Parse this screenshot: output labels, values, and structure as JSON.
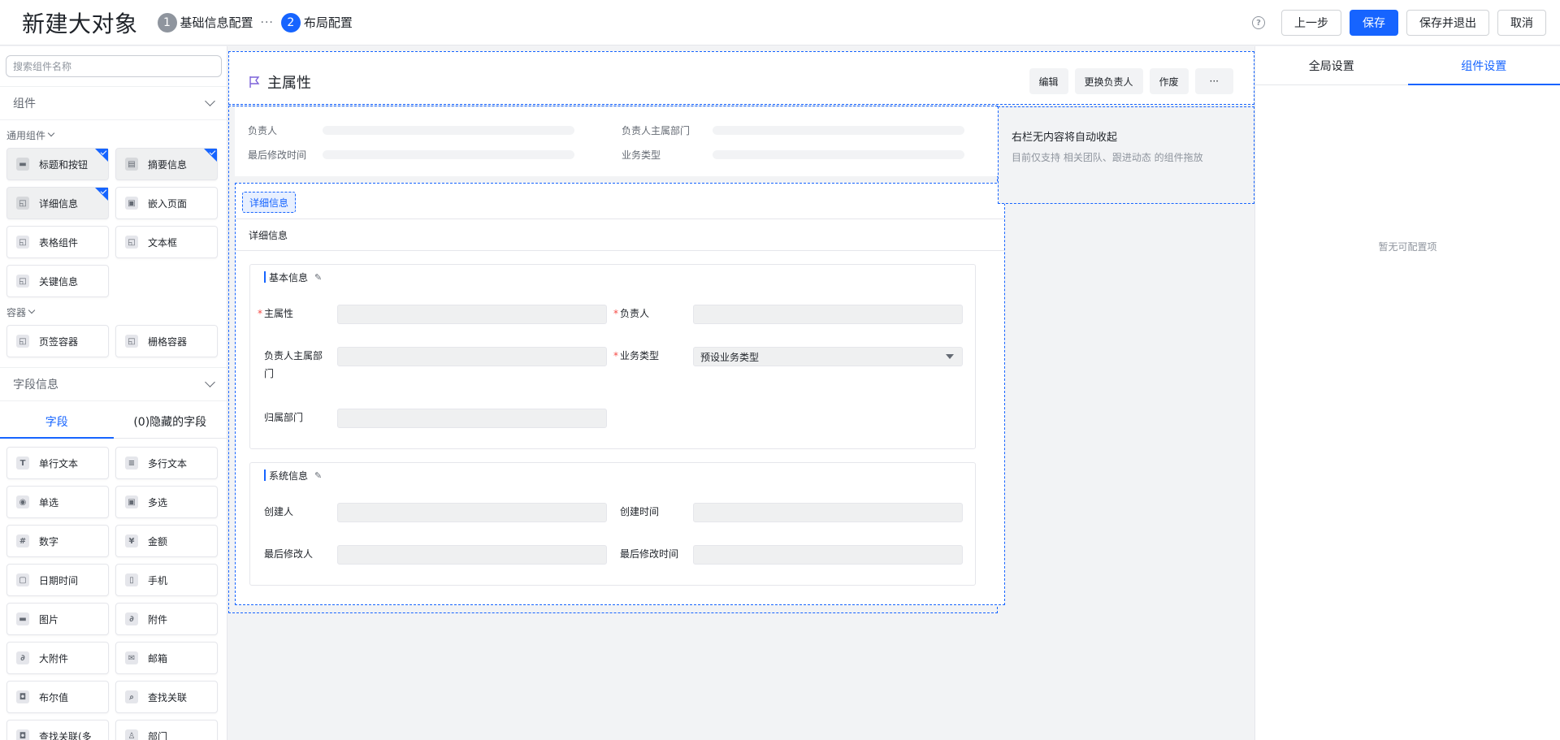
{
  "header": {
    "title": "新建大对象",
    "steps": [
      {
        "num": "1",
        "label": "基础信息配置"
      },
      {
        "num": "2",
        "label": "布局配置"
      }
    ],
    "dots": "···",
    "help_glyph": "?",
    "buttons": {
      "prev": "上一步",
      "save": "保存",
      "save_exit": "保存并退出",
      "cancel": "取消"
    }
  },
  "sidebar": {
    "search_placeholder": "搜索组件名称",
    "components_title": "组件",
    "common_label": "通用组件",
    "common_items": [
      "标题和按钮",
      "摘要信息",
      "详细信息",
      "嵌入页面",
      "表格组件",
      "文本框",
      "关键信息"
    ],
    "container_label": "容器",
    "container_items": [
      "页签容器",
      "栅格容器"
    ],
    "fields_title": "字段信息",
    "tabs": {
      "fields": "字段",
      "hidden": "(0)隐藏的字段"
    },
    "field_items": [
      {
        "label": "单行文本",
        "icon": "T"
      },
      {
        "label": "多行文本",
        "icon": "≡"
      },
      {
        "label": "单选",
        "icon": "◉"
      },
      {
        "label": "多选",
        "icon": "▣"
      },
      {
        "label": "数字",
        "icon": "#"
      },
      {
        "label": "金额",
        "icon": "¥"
      },
      {
        "label": "日期时间",
        "icon": "▢"
      },
      {
        "label": "手机",
        "icon": "▯"
      },
      {
        "label": "图片",
        "icon": "▬"
      },
      {
        "label": "附件",
        "icon": "∂"
      },
      {
        "label": "大附件",
        "icon": "∂"
      },
      {
        "label": "邮箱",
        "icon": "✉"
      },
      {
        "label": "布尔值",
        "icon": "◘"
      },
      {
        "label": "查找关联",
        "icon": "⌕"
      },
      {
        "label": "查找关联(多",
        "icon": "◘"
      },
      {
        "label": "部门",
        "icon": "♙"
      }
    ]
  },
  "canvas": {
    "header_title": "主属性",
    "header_buttons": [
      "编辑",
      "更换负责人",
      "作废",
      "···"
    ],
    "summary_labels": [
      "负责人",
      "负责人主属部门",
      "最后修改时间",
      "业务类型"
    ],
    "detail_tag": "详细信息",
    "detail_subtitle": "详细信息",
    "basic_title": "基本信息",
    "basic_fields": {
      "main_attr": "主属性",
      "owner": "负责人",
      "owner_dept": "负责人主属部",
      "owner_dept_wrap": "门",
      "biz_type": "业务类型",
      "biz_type_value": "预设业务类型",
      "belong_dept": "归属部门"
    },
    "system_title": "系统信息",
    "system_fields": {
      "creator": "创建人",
      "created_time": "创建时间",
      "last_modifier": "最后修改人",
      "last_modified_time": "最后修改时间"
    },
    "right_col": {
      "title": "右栏无内容将自动收起",
      "subtitle": "目前仅支持 相关团队、跟进动态 的组件拖放"
    }
  },
  "panel": {
    "tabs": [
      "全局设置",
      "组件设置"
    ],
    "empty": "暂无可配置项"
  },
  "colors": {
    "accent": "#1664ff",
    "required": "#f54a45"
  }
}
